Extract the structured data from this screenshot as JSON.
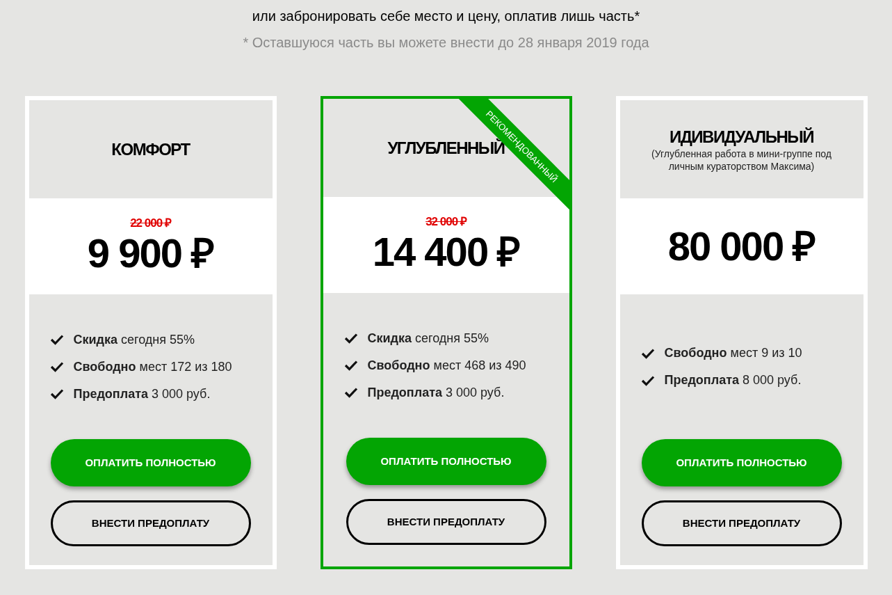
{
  "intro": {
    "line": "или забронировать себе место и цену, оплатив лишь часть*",
    "footnote": "* Оставшуюся часть вы можете внести до 28 января 2019 года"
  },
  "plans": [
    {
      "title": "КОМФОРТ",
      "recommended": false,
      "old_price": "22 000 ₽",
      "price": "9 900 ₽",
      "features": [
        "**Скидка** сегодня 55%",
        "**Свободно** мест 172 из 180",
        "**Предоплата** 3 000 руб."
      ],
      "buttons": [
        "ОПЛАТИТЬ ПОЛНОСТЬЮ",
        "ВНЕСТИ ПРЕДОПЛАТУ"
      ]
    },
    {
      "title": "УГЛУБЛЕННЫЙ",
      "recommended": true,
      "ribbon": "РЕКОМЕНДОВАННЫЙ",
      "old_price": "32 000 ₽",
      "price": "14 400 ₽",
      "features": [
        "**Скидка** сегодня 55%",
        "**Свободно** мест 468 из 490",
        "**Предоплата** 3 000 руб."
      ],
      "buttons": [
        "ОПЛАТИТЬ ПОЛНОСТЬЮ",
        "ВНЕСТИ ПРЕДОПЛАТУ"
      ]
    },
    {
      "title": "ИДИВИДУАЛЬНЫЙ",
      "subtitle": "(Углубленная работа в мини-группе под личным кураторством Максима)",
      "recommended": false,
      "price": "80 000 ₽",
      "features": [
        "**Свободно** мест 9 из 10",
        "**Предоплата** 8 000 руб."
      ],
      "buttons": [
        "ОПЛАТИТЬ ПОЛНОСТЬЮ",
        "ВНЕСТИ ПРЕДОПЛАТУ"
      ]
    }
  ]
}
